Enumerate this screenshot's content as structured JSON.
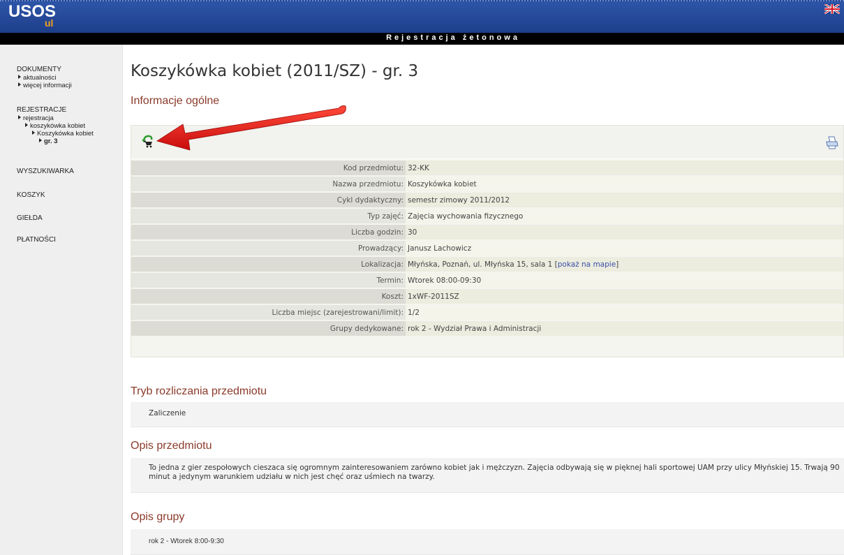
{
  "header": {
    "logo": "USOS",
    "logo_sub": "ul",
    "language_icon": "uk-flag-icon",
    "banner_title": "Rejestracja żetonowa"
  },
  "sidebar": {
    "dokumenty": {
      "label": "DOKUMENTY",
      "items": [
        "aktualności",
        "więcej informacji"
      ]
    },
    "rejestracje": {
      "label": "REJESTRACJE",
      "items": [
        "rejestracja",
        "koszykówka kobiet",
        "Koszykówka kobiet",
        "gr. 3"
      ]
    },
    "links": [
      "WYSZUKIWARKA",
      "KOSZYK",
      "GIEŁDA",
      "PŁATNOŚCI"
    ]
  },
  "main": {
    "page_title": "Koszykówka kobiet (2011/SZ) - gr. 3",
    "info_title": "Informacje ogólne",
    "toolbar": {
      "cart_icon": "cart-return-icon",
      "print_icon": "print-icon"
    },
    "details": [
      {
        "label": "Kod przedmiotu:",
        "value": "32-KK"
      },
      {
        "label": "Nazwa przedmiotu:",
        "value": "Koszykówka kobiet"
      },
      {
        "label": "Cykl dydaktyczny:",
        "value": "semestr zimowy 2011/2012"
      },
      {
        "label": "Typ zajęć:",
        "value": "Zajęcia wychowania fizycznego"
      },
      {
        "label": "Liczba godzin:",
        "value": "30"
      },
      {
        "label": "Prowadzący:",
        "value": "Janusz Lachowicz"
      },
      {
        "label": "Lokalizacja:",
        "value": "Młyńska, Poznań, ul. Młyńska 15, sala 1 [",
        "link": "pokaż na mapie",
        "value_end": "]"
      },
      {
        "label": "Termin:",
        "value": "Wtorek 08:00-09:30"
      },
      {
        "label": "Koszt:",
        "value": "1xWF-2011SZ"
      },
      {
        "label": "Liczba miejsc (zarejestrowani/limit):",
        "value": "1/2"
      },
      {
        "label": "Grupy dedykowane:",
        "value": "rok 2 - Wydział Prawa i Administracji"
      }
    ],
    "tryb_title": "Tryb rozliczania przedmiotu",
    "tryb_text": "Zaliczenie",
    "opis_title": "Opis przedmiotu",
    "opis_text": "To jedna z gier zespołowych cieszaca się ogromnym zainteresowaniem zarówno kobiet jak i mężczyzn. Zajęcia odbywają się w pięknej hali sportowej UAM przy ulicy Młyńskiej 15. Trwają 90 minut a jedynym warunkiem udziału w nich jest chęć oraz uśmiech na twarzy.",
    "grupa_title": "Opis grupy",
    "grupa_text": "rok 2 - Wtorek 8:00-9:30"
  },
  "colors": {
    "header_blue": "#2d55a8",
    "section_title": "#8a3a2a",
    "arrow_red": "#e01818",
    "logo_orange": "#f0a020"
  }
}
